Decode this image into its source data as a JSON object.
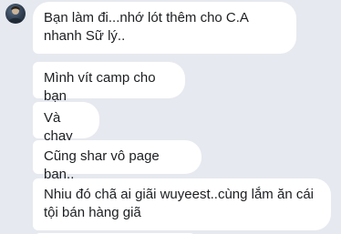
{
  "conversation": {
    "messages": [
      {
        "text": "Bạn làm đi...nhớ lót thêm cho C.A nhanh Sữ lý.."
      },
      {
        "text": "Mình vít camp cho bạn"
      },
      {
        "text": "Và chạy"
      },
      {
        "text": "Cũng shar vô page bạn.."
      },
      {
        "text": "Nhiu đó chã ai giãi wuyeest..cùng lắm ăn cái tội bán hàng giã"
      }
    ]
  },
  "colors": {
    "background": "#e6e9ef",
    "bubble": "#ffffff",
    "text": "#1c1e21"
  },
  "icons": {
    "avatar": "contact-avatar-icon"
  }
}
